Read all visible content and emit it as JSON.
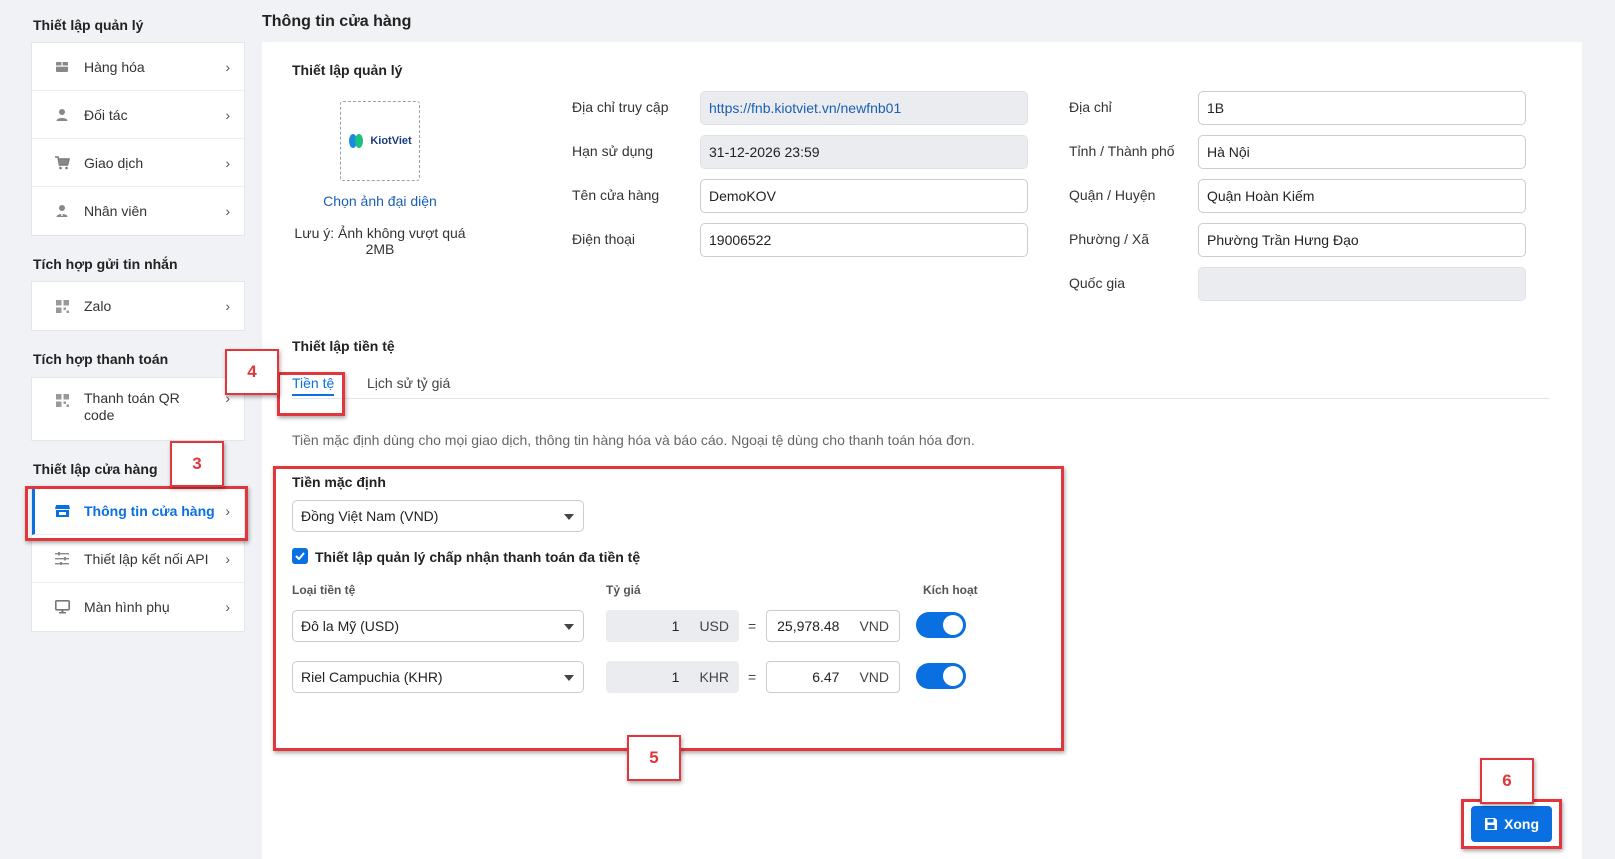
{
  "sidebar": {
    "sections": [
      {
        "title": "Thiết lập quản lý",
        "items": [
          {
            "label": "Hàng hóa",
            "icon": "box-icon"
          },
          {
            "label": "Đối tác",
            "icon": "user-icon"
          },
          {
            "label": "Giao dịch",
            "icon": "cart-icon"
          },
          {
            "label": "Nhân viên",
            "icon": "employee-icon"
          }
        ]
      },
      {
        "title": "Tích hợp gửi tin nhắn",
        "items": [
          {
            "label": "Zalo",
            "icon": "grid-icon"
          }
        ]
      },
      {
        "title": "Tích hợp thanh toán",
        "items": [
          {
            "label": "Thanh toán QR code",
            "icon": "qr-icon"
          }
        ]
      },
      {
        "title": "Thiết lập cửa hàng",
        "items": [
          {
            "label": "Thông tin cửa hàng",
            "icon": "store-icon",
            "active": true
          },
          {
            "label": "Thiết lập kết nối API",
            "icon": "sliders-icon"
          },
          {
            "label": "Màn hình phụ",
            "icon": "monitor-icon"
          }
        ]
      }
    ]
  },
  "page": {
    "title": "Thông tin cửa hàng"
  },
  "management": {
    "title": "Thiết lập quản lý",
    "logo_text": "KiotViet",
    "choose_avatar": "Chọn ảnh đại diện",
    "avatar_note": "Lưu ý: Ảnh không vượt quá 2MB",
    "fields_left": [
      {
        "label": "Địa chỉ truy cập",
        "value": "https://fnb.kiotviet.vn/newfnb01"
      },
      {
        "label": "Hạn sử dụng",
        "value": "31-12-2026 23:59"
      },
      {
        "label": "Tên cửa hàng",
        "value": "DemoKOV"
      },
      {
        "label": "Điện thoại",
        "value": "19006522"
      }
    ],
    "fields_right": [
      {
        "label": "Địa chỉ",
        "value": "1B"
      },
      {
        "label": "Tỉnh / Thành phố",
        "value": "Hà Nội"
      },
      {
        "label": "Quận / Huyện",
        "value": "Quận Hoàn Kiếm"
      },
      {
        "label": "Phường / Xã",
        "value": "Phường Trần Hưng Đạo"
      },
      {
        "label": "Quốc gia",
        "value": ""
      }
    ]
  },
  "currency": {
    "title": "Thiết lập tiền tệ",
    "tabs": [
      "Tiền tệ",
      "Lịch sử tỷ giá"
    ],
    "description": "Tiền mặc định dùng cho mọi giao dịch, thông tin hàng hóa và báo cáo. Ngoại tệ dùng cho thanh toán hóa đơn.",
    "default_label": "Tiền mặc định",
    "default_value": "Đồng Việt Nam (VND)",
    "multi_label": "Thiết lập quản lý chấp nhận thanh toán đa tiền tệ",
    "multi_checked": true,
    "col_type": "Loại tiền tệ",
    "col_rate": "Tỷ giá",
    "col_active": "Kích hoạt",
    "rows": [
      {
        "type": "Đô la Mỹ (USD)",
        "qty": "1",
        "code": "USD",
        "eq": "=",
        "rate": "25,978.48",
        "base": "VND",
        "active": true
      },
      {
        "type": "Riel Campuchia (KHR)",
        "qty": "1",
        "code": "KHR",
        "eq": "=",
        "rate": "6.47",
        "base": "VND",
        "active": true
      }
    ]
  },
  "actions": {
    "done_label": "Xong"
  },
  "annotations": {
    "badges": [
      "3",
      "4",
      "5",
      "6"
    ],
    "color": "#e0363c"
  },
  "colors": {
    "accent": "#0a6fe0",
    "annotation": "#e0363c"
  }
}
